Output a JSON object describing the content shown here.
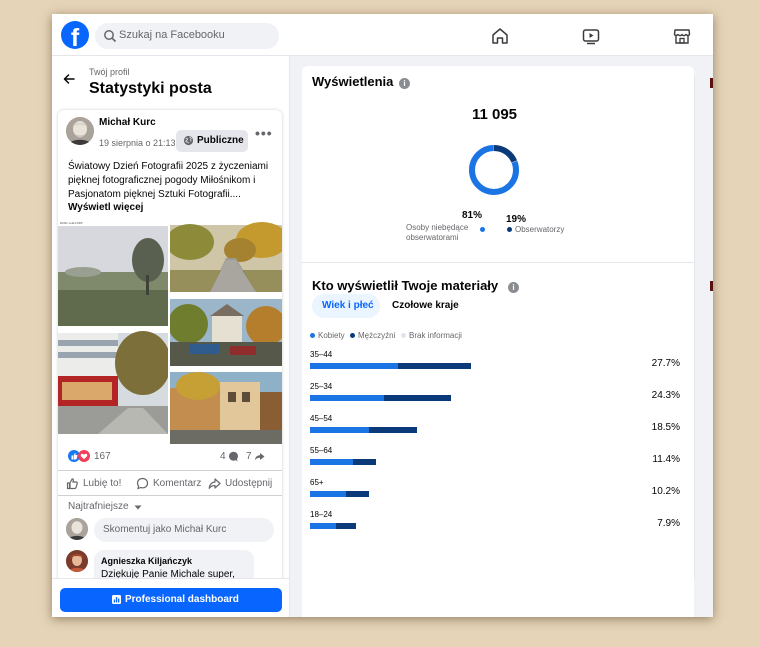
{
  "topbar": {
    "logo": "f",
    "search_placeholder": "Szukaj na Facebooku",
    "nav_icons": [
      "home-icon",
      "video-icon",
      "marketplace-icon"
    ]
  },
  "header": {
    "breadcrumb": "Twój profil",
    "title": "Statystyki posta"
  },
  "post": {
    "author": "Michał Kurc",
    "date": "19 sierpnia o 21:13 ·",
    "audience": "Publiczne",
    "more": "•••",
    "text": "Światowy Dzień Fotografii 2025 z życzeniami pięknej fotograficznej pogody Miłośnikom i Pasjonatom pięknej Sztuki Fotografii....",
    "see_more": "Wyświetl więcej",
    "reaction_count": "167",
    "comment_count": "4",
    "share_count": "7",
    "actions": {
      "like": "Lubię to!",
      "comment": "Komentarz",
      "share": "Udostępnij"
    },
    "sort_label": "Najtrafniejsze",
    "comment_placeholder": "Skomentuj jako Michał Kurc",
    "top_comment": {
      "author": "Agnieszka Kiljańczyk",
      "text": "Dziękuję Panie Michale super,"
    }
  },
  "footer": {
    "button": "Professional dashboard"
  },
  "views": {
    "title": "Wyświetlenia",
    "info": "i",
    "total": "11 095",
    "non_followers_pct": "81%",
    "non_followers_label_1": "Osoby niebędące",
    "non_followers_label_2": "obserwatorami",
    "followers_pct": "19%",
    "followers_label": "Obserwatorzy",
    "non_followers_fraction": 0.81,
    "followers_fraction": 0.19
  },
  "who": {
    "title": "Kto wyświetlił Twoje materiały",
    "info": "i",
    "tabs": [
      "Wiek i płeć",
      "Czołowe kraje"
    ],
    "legend": [
      "Kobiety",
      "Mężczyźni",
      "Brak informacji"
    ],
    "rows": [
      {
        "age": "35–44",
        "pct": "27.7%",
        "women": 15.2,
        "men": 12.5
      },
      {
        "age": "25–34",
        "pct": "24.3%",
        "women": 12.7,
        "men": 11.6
      },
      {
        "age": "45–54",
        "pct": "18.5%",
        "women": 10.2,
        "men": 8.3
      },
      {
        "age": "55–64",
        "pct": "11.4%",
        "women": 7.4,
        "men": 4.0
      },
      {
        "age": "65+",
        "pct": "10.2%",
        "women": 6.2,
        "men": 4.0
      },
      {
        "age": "18–24",
        "pct": "7.9%",
        "women": 4.4,
        "men": 3.5
      }
    ]
  },
  "colors": {
    "brand": "#0866ff",
    "women": "#1b74e4",
    "men": "#0a3a7a",
    "unknown": "#dfe4ea"
  }
}
